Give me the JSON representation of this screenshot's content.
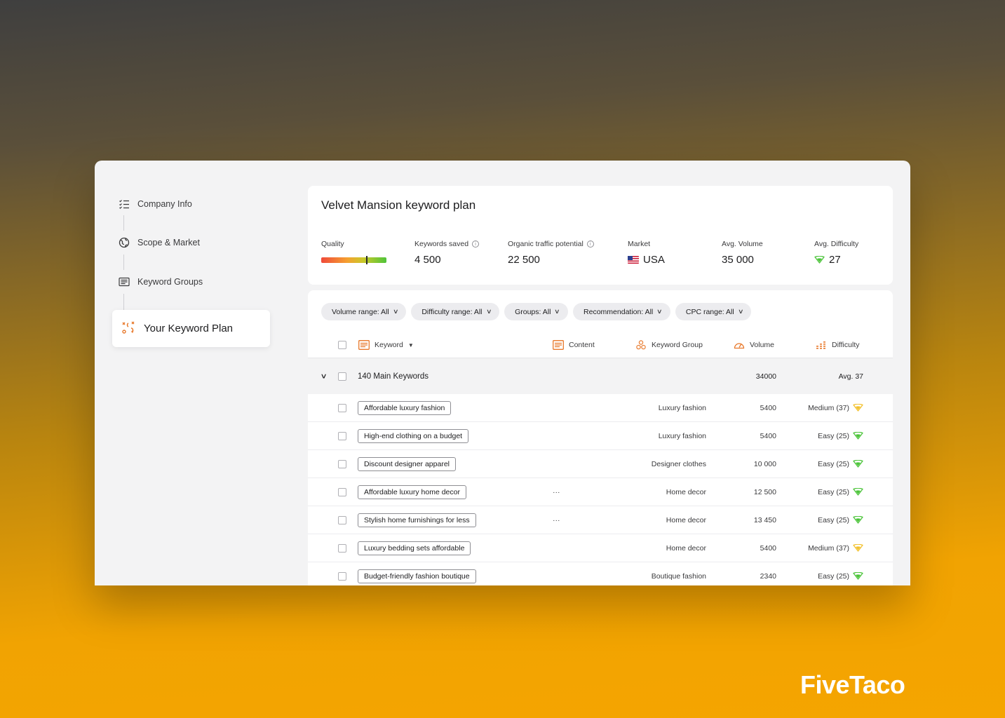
{
  "steps": [
    {
      "label": "Company Info",
      "icon": "checklist-icon"
    },
    {
      "label": "Scope & Market",
      "icon": "globe-icon"
    },
    {
      "label": "Keyword Groups",
      "icon": "list-card-icon"
    },
    {
      "label": "Your Keyword Plan",
      "icon": "strategy-icon"
    }
  ],
  "summary": {
    "title": "Velvet Mansion keyword plan",
    "quality_label": "Quality",
    "quality_value": 0.7,
    "keywords_saved_label": "Keywords saved",
    "keywords_saved": "4 500",
    "traffic_label": "Organic traffic potential",
    "traffic": "22 500",
    "market_label": "Market",
    "market": "USA",
    "avg_volume_label": "Avg. Volume",
    "avg_volume": "35 000",
    "avg_difficulty_label": "Avg. Difficulty",
    "avg_difficulty": "27"
  },
  "filters": [
    "Volume range: All",
    "Difficulty range: All",
    "Groups: All",
    "Recommendation: All",
    "CPC range: All"
  ],
  "columns": {
    "keyword": "Keyword",
    "content": "Content",
    "group": "Keyword Group",
    "volume": "Volume",
    "difficulty": "Difficulty"
  },
  "group_row": {
    "label": "140 Main Keywords",
    "volume": "34000",
    "difficulty": "Avg. 37"
  },
  "rows": [
    {
      "keyword": "Affordable luxury fashion",
      "content": "",
      "group": "Luxury fashion",
      "volume": "5400",
      "difficulty": "Medium (37)",
      "level": "medium"
    },
    {
      "keyword": "High-end clothing on a budget",
      "content": "",
      "group": "Luxury fashion",
      "volume": "5400",
      "difficulty": "Easy (25)",
      "level": "easy"
    },
    {
      "keyword": "Discount designer apparel",
      "content": "",
      "group": "Designer clothes",
      "volume": "10 000",
      "difficulty": "Easy (25)",
      "level": "easy"
    },
    {
      "keyword": "Affordable luxury home decor",
      "content": "···",
      "group": "Home decor",
      "volume": "12 500",
      "difficulty": "Easy (25)",
      "level": "easy"
    },
    {
      "keyword": "Stylish home furnishings for less",
      "content": "···",
      "group": "Home decor",
      "volume": "13 450",
      "difficulty": "Easy (25)",
      "level": "easy"
    },
    {
      "keyword": "Luxury bedding sets affordable",
      "content": "",
      "group": "Home decor",
      "volume": "5400",
      "difficulty": "Medium (37)",
      "level": "medium"
    },
    {
      "keyword": "Budget-friendly fashion boutique",
      "content": "",
      "group": "Boutique fashion",
      "volume": "2340",
      "difficulty": "Easy (25)",
      "level": "easy"
    }
  ],
  "colors": {
    "accent": "#e8782a",
    "easy": "#4cc43a",
    "medium": "#f2c12e"
  },
  "brand": "FiveTaco"
}
